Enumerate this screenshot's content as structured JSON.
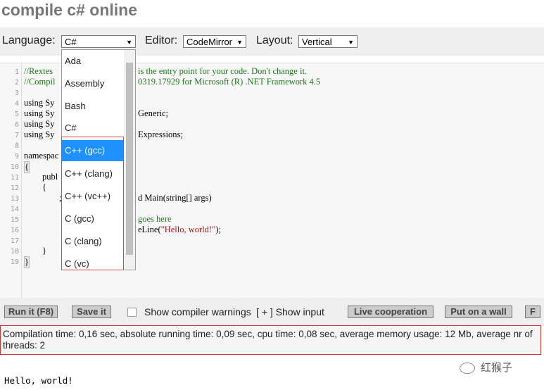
{
  "page": {
    "title": "compile c# online"
  },
  "toolbar": {
    "language_label": "Language:",
    "language_value": "C#",
    "editor_label": "Editor:",
    "editor_value": "CodeMirror",
    "layout_label": "Layout:",
    "layout_value": "Vertical"
  },
  "editor": {
    "line_numbers": [
      "1",
      "2",
      "3",
      "4",
      "5",
      "6",
      "7",
      "8",
      "9",
      "10",
      "11",
      "12",
      "13",
      "14",
      "15",
      "16",
      "17",
      "18",
      "19"
    ],
    "lines": {
      "l1": "//Rextes",
      "l1b": "is the entry point for your code. Don't change it.",
      "l2": "//Compil",
      "l2b": "0319.17929 for Microsoft (R) .NET Framework 4.5",
      "l4": "using Sy",
      "l5": "using Sy",
      "l5b": "Generic;",
      "l6": "using Sy",
      "l7": "using Sy",
      "l7b": "Expressions;",
      "l9": "namespac",
      "l10": "{",
      "l11": "publ",
      "l12": "{",
      "l13": ";",
      "l13b": "d Main(string[] args)",
      "l15b": "goes here",
      "l16b": "eLine(",
      "l16s": "\"Hello, world!\"",
      "l16c": ");",
      "l18": "}",
      "l19": "}"
    }
  },
  "dropdown": {
    "options": [
      "Ada",
      "Assembly",
      "Bash",
      "C#",
      "C++ (gcc)",
      "C++ (clang)",
      "C++ (vc++)",
      "C (gcc)",
      "C (clang)",
      "C (vc)"
    ],
    "highlighted": "C++ (gcc)"
  },
  "actions": {
    "run": "Run it (F8)",
    "save": "Save it",
    "warnings": "Show compiler warnings",
    "show_input": "[ + ] Show input",
    "live": "Live cooperation",
    "wall": "Put on a wall",
    "f": "F"
  },
  "status": {
    "text": "Compilation time: 0,16 sec, absolute running time: 0,09 sec, cpu time: 0,08 sec, average memory usage: 12 Mb, average nr of threads: 2"
  },
  "output": {
    "text": "Hello, world!"
  },
  "watermark": {
    "text": "红猴子"
  }
}
